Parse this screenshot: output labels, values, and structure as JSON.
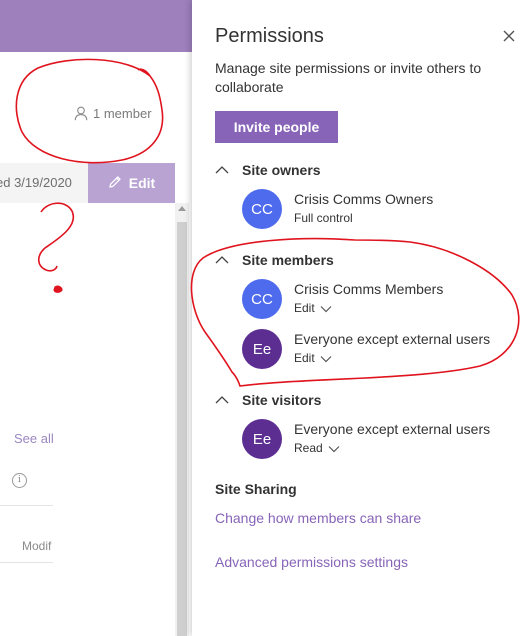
{
  "background": {
    "member_count": "1 member",
    "edited_text": "ed 3/19/2020",
    "edit_button_label": "Edit",
    "see_all_label": "See all",
    "column_modified": "Modif"
  },
  "panel": {
    "title": "Permissions",
    "description": "Manage site permissions or invite others to collaborate",
    "invite_label": "Invite people",
    "sections": [
      {
        "label": "Site owners",
        "members": [
          {
            "initials": "CC",
            "name": "Crisis Comms Owners",
            "role": "Full control",
            "avatar_color": "#4f6bed"
          }
        ]
      },
      {
        "label": "Site members",
        "members": [
          {
            "initials": "CC",
            "name": "Crisis Comms Members",
            "role": "Edit",
            "avatar_color": "#4f6bed"
          },
          {
            "initials": "Ee",
            "name": "Everyone except external users",
            "role": "Edit",
            "avatar_color": "#5c2e91"
          }
        ]
      },
      {
        "label": "Site visitors",
        "members": [
          {
            "initials": "Ee",
            "name": "Everyone except external users",
            "role": "Read",
            "avatar_color": "#5c2e91"
          }
        ]
      }
    ],
    "sharing_title": "Site Sharing",
    "change_sharing_link": "Change how members can share",
    "advanced_link": "Advanced permissions settings"
  },
  "annotation": {
    "question_mark": "?",
    "color": "#e0141e"
  },
  "colors": {
    "accent": "#8764b8",
    "suite_bar": "#9e80bd",
    "edit_button_dimmed": "#b8a3d3"
  }
}
